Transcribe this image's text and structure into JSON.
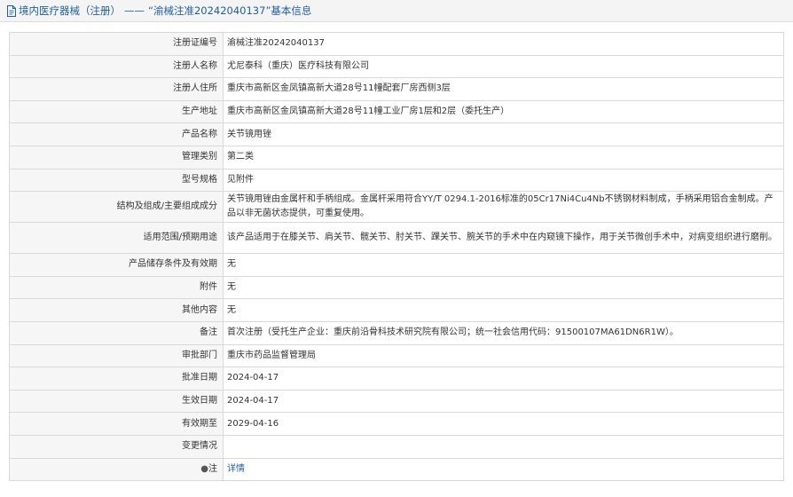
{
  "header": {
    "category": "境内医疗器械（注册）",
    "separator": "——",
    "title": "“渝械注准20242040137”基本信息"
  },
  "rows": [
    {
      "label": "注册证编号",
      "value": "渝械注准20242040137"
    },
    {
      "label": "注册人名称",
      "value": "尤尼泰科（重庆）医疗科技有限公司"
    },
    {
      "label": "注册人住所",
      "value": "重庆市高新区金凤镇高新大道28号11幢配套厂房西侧3层"
    },
    {
      "label": "生产地址",
      "value": "重庆市高新区金凤镇高新大道28号11幢工业厂房1层和2层（委托生产）"
    },
    {
      "label": "产品名称",
      "value": "关节镜用锉"
    },
    {
      "label": "管理类别",
      "value": "第二类"
    },
    {
      "label": "型号规格",
      "value": "见附件"
    },
    {
      "label": "结构及组成/主要组成成分",
      "value": "关节镜用锉由金属杆和手柄组成。金属杆采用符合YY/T 0294.1-2016标准的05Cr17Ni4Cu4Nb不锈钢材料制成，手柄采用铝合金制成。产品以非无菌状态提供，可重复使用。"
    },
    {
      "label": "适用范围/预期用途",
      "value": "该产品适用于在膝关节、肩关节、髋关节、肘关节、踝关节、腕关节的手术中在内窥镜下操作，用于关节微创手术中，对病变组织进行磨削。"
    },
    {
      "label": "产品储存条件及有效期",
      "value": "无"
    },
    {
      "label": "附件",
      "value": "无"
    },
    {
      "label": "其他内容",
      "value": "无"
    },
    {
      "label": "备注",
      "value": "首次注册（受托生产企业：重庆前沿骨科技术研究院有限公司；统一社会信用代码：91500107MA61DN6R1W）。"
    },
    {
      "label": "审批部门",
      "value": "重庆市药品监督管理局"
    },
    {
      "label": "批准日期",
      "value": "2024-04-17"
    },
    {
      "label": "生效日期",
      "value": "2024-04-17"
    },
    {
      "label": "有效期至",
      "value": "2029-04-16"
    },
    {
      "label": "变更情况",
      "value": ""
    }
  ],
  "note_row": {
    "label": "注",
    "link": "详情"
  },
  "colors": {
    "header_text": "#1f5f9e",
    "label_bg": "#f6f6f6",
    "border": "#d9d9d9"
  },
  "icons": {
    "header": "document-icon",
    "note": "pin-icon"
  }
}
